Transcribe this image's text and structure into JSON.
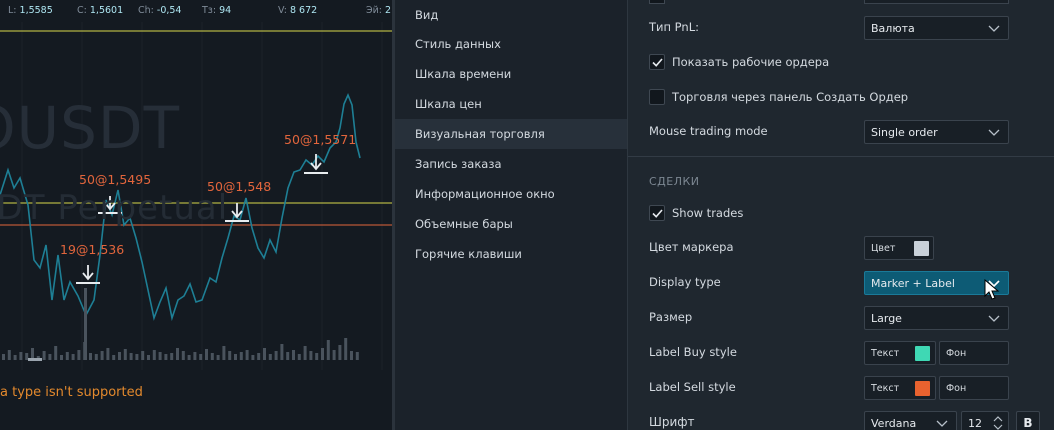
{
  "chart": {
    "stats": [
      {
        "key": "L:",
        "value": "1,5585"
      },
      {
        "key": "C:",
        "value": "1,5601"
      },
      {
        "key": "Ch:",
        "value": "-0,54"
      },
      {
        "key": "Тз:",
        "value": "94"
      },
      {
        "key": "V:",
        "value": "8 672"
      },
      {
        "key": "Эй:",
        "value": "2"
      }
    ],
    "symbol_watermark": "OUSDT",
    "symbol_sub_watermark": "SDT Perpetual",
    "trades": [
      {
        "label": "19@1,536"
      },
      {
        "label": "50@1,5495"
      },
      {
        "label": "50@1,548"
      },
      {
        "label": "50@1,5571"
      }
    ],
    "unsupported_message": "a type isn't supported",
    "colors": {
      "price_line": "#1e7f95",
      "upper_level": "#d8d84a",
      "lower_level": "#e2653c",
      "trade_label": "#e2653c"
    }
  },
  "nav": {
    "items": [
      {
        "label": "Вид"
      },
      {
        "label": "Стиль данных"
      },
      {
        "label": "Шкала времени"
      },
      {
        "label": "Шкала цен"
      },
      {
        "label": "Визуальная торговля",
        "active": true
      },
      {
        "label": "Запись заказа"
      },
      {
        "label": "Информационное окно"
      },
      {
        "label": "Объемные бары"
      },
      {
        "label": "Горячие клавиши"
      }
    ]
  },
  "panel": {
    "pnl_type": {
      "label": "Тип PnL:",
      "value": "Валюта"
    },
    "show_working_orders": {
      "label": "Показать рабочие ордера",
      "checked": true
    },
    "trade_via_panel": {
      "label": "Торговля через панель Создать Ордер",
      "checked": false
    },
    "mouse_trading_mode": {
      "label": "Mouse trading mode",
      "value": "Single order"
    },
    "section_trades": "СДЕЛКИ",
    "show_trades": {
      "label": "Show trades",
      "checked": true
    },
    "marker_color": {
      "label": "Цвет маркера",
      "button_text": "Цвет",
      "swatch": "#c9d1d9"
    },
    "display_type": {
      "label": "Display type",
      "value": "Marker + Label"
    },
    "size": {
      "label": "Размер",
      "value": "Large"
    },
    "label_buy_style": {
      "label": "Label Buy style",
      "text": "Текст",
      "bg": "Фон",
      "swatch": "#3fd8b4"
    },
    "label_sell_style": {
      "label": "Label Sell style",
      "text": "Текст",
      "bg": "Фон",
      "swatch": "#e8622f"
    },
    "font": {
      "label": "Шрифт",
      "family": "Verdana",
      "size": "12",
      "bold_label": "B"
    }
  }
}
